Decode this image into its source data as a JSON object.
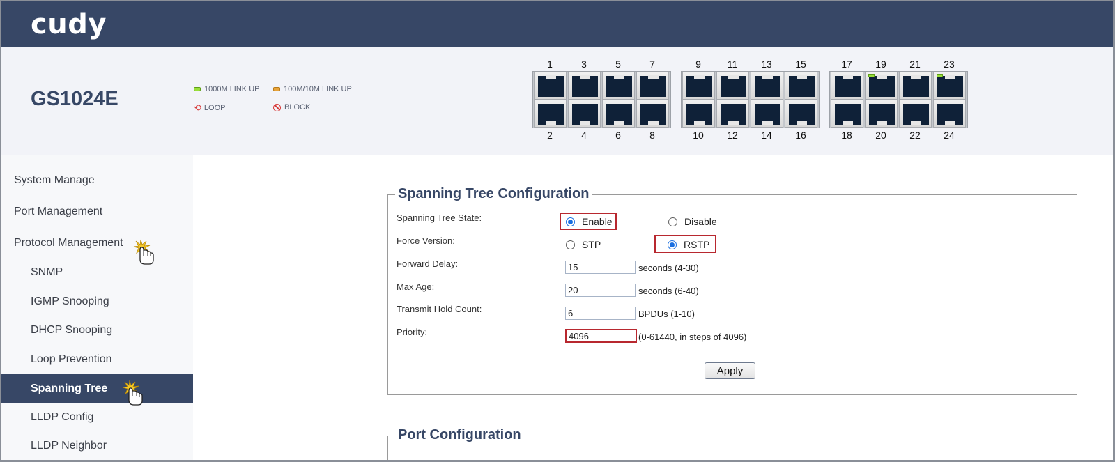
{
  "brand": {
    "logo_text": "cudy",
    "model": "GS1024E"
  },
  "legend": {
    "link_1000": "1000M LINK UP",
    "link_100": "100M/10M LINK UP",
    "loop": "LOOP",
    "block": "BLOCK",
    "colors": {
      "link_1000": "#9adf3a",
      "link_100": "#e8a33a",
      "loop": "#d83a3a",
      "block": "#d83a3a"
    }
  },
  "ports": {
    "top_numbers": [
      "1",
      "3",
      "5",
      "7",
      "9",
      "11",
      "13",
      "15",
      "17",
      "19",
      "21",
      "23"
    ],
    "bottom_numbers": [
      "2",
      "4",
      "6",
      "8",
      "10",
      "12",
      "14",
      "16",
      "18",
      "20",
      "22",
      "24"
    ],
    "link_up_1000": [
      "19",
      "23"
    ]
  },
  "sidebar": {
    "items": [
      {
        "label": "System Manage",
        "level": 1
      },
      {
        "label": "Port Management",
        "level": 1
      },
      {
        "label": "Protocol Management",
        "level": 1
      },
      {
        "label": "SNMP",
        "level": 2
      },
      {
        "label": "IGMP Snooping",
        "level": 2
      },
      {
        "label": "DHCP Snooping",
        "level": 2
      },
      {
        "label": "Loop Prevention",
        "level": 2
      },
      {
        "label": "Spanning Tree",
        "level": 2,
        "active": true
      },
      {
        "label": "LLDP Config",
        "level": 2
      },
      {
        "label": "LLDP Neighbor",
        "level": 2
      }
    ]
  },
  "stp": {
    "title": "Spanning Tree Configuration",
    "state_label": "Spanning Tree State:",
    "state_enable": "Enable",
    "state_disable": "Disable",
    "state_value": "Enable",
    "version_label": "Force Version:",
    "version_stp": "STP",
    "version_rstp": "RSTP",
    "version_value": "RSTP",
    "forward_delay_label": "Forward Delay:",
    "forward_delay_value": "15",
    "forward_delay_unit": "seconds (4-30)",
    "max_age_label": "Max Age:",
    "max_age_value": "20",
    "max_age_unit": "seconds (6-40)",
    "hold_label": "Transmit Hold Count:",
    "hold_value": "6",
    "hold_unit": "BPDUs (1-10)",
    "priority_label": "Priority:",
    "priority_value": "4096",
    "priority_unit": "(0-61440, in steps of 4096)",
    "apply_label": "Apply"
  },
  "port_config": {
    "title": "Port Configuration"
  }
}
